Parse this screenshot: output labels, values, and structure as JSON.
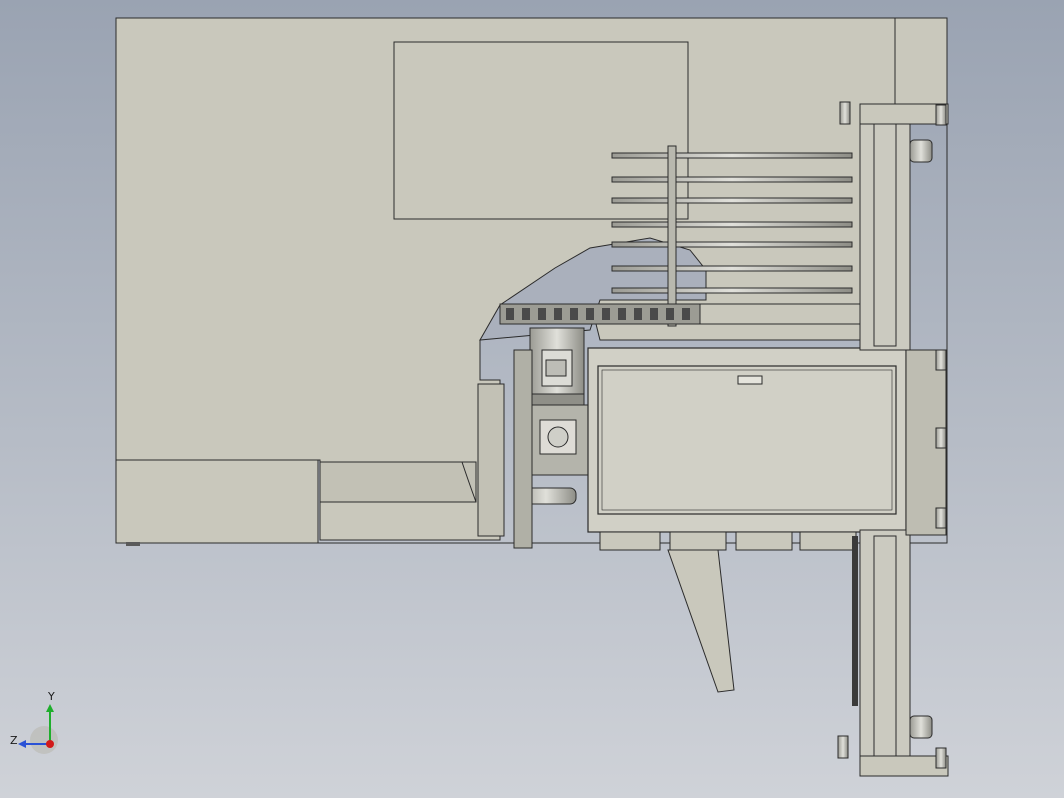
{
  "window": {
    "title": ""
  },
  "colors": {
    "background_top": "#9aa3b2",
    "background_bottom": "#cfd2d8",
    "part_fill": "#c9c8bc",
    "part_dark": "#a9a89c",
    "edge": "#2b2b2b",
    "axis_x": "#d21a1a",
    "axis_y": "#1fae2c",
    "axis_z": "#2a52d6"
  },
  "triad": {
    "y_label": "Y",
    "z_label": "Z"
  },
  "model": {
    "icons": [
      "motor-icon",
      "gearbox-icon",
      "cable-chain-icon",
      "leveling-foot-icon",
      "roller-conveyor-icon"
    ]
  }
}
